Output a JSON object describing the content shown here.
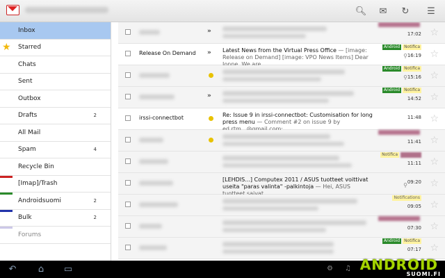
{
  "topbar": {
    "icons": [
      "search-icon",
      "compose-icon",
      "refresh-icon",
      "menu-icon"
    ]
  },
  "sidebar": {
    "items": [
      {
        "label": "Inbox",
        "count": "",
        "active": true
      },
      {
        "label": "Starred",
        "count": ""
      },
      {
        "label": "Chats",
        "count": ""
      },
      {
        "label": "Sent",
        "count": ""
      },
      {
        "label": "Outbox",
        "count": ""
      },
      {
        "label": "Drafts",
        "count": "2"
      },
      {
        "label": "All Mail",
        "count": ""
      },
      {
        "label": "Spam",
        "count": "4"
      },
      {
        "label": "Recycle Bin",
        "count": ""
      },
      {
        "label": "[Imap]/Trash",
        "count": "",
        "color": "#cc2222"
      },
      {
        "label": "Androidsuomi",
        "count": "2",
        "color": "#2a8a2a"
      },
      {
        "label": "Bulk",
        "count": "2",
        "color": "#2233aa"
      },
      {
        "label": "Forums",
        "count": "",
        "color": "#ccc8e8"
      }
    ]
  },
  "mails": [
    {
      "sender": "",
      "subject": "",
      "snippet": "",
      "time": "17:02",
      "marker": "»",
      "tags": []
    },
    {
      "sender": "Release On Demand",
      "subject": "Latest News from the Virtual Press Office",
      "snippet": " — [image: Release on Demand] [image: VPO News Items] Dear Jonne, We are",
      "time": "16:19",
      "marker": "»",
      "tags": [
        "Android",
        "Notifica"
      ],
      "attach": true
    },
    {
      "sender": "",
      "subject": "",
      "snippet": "",
      "time": "15:16",
      "marker": "imp",
      "tags": [
        "Android",
        "Notifica"
      ],
      "attach": true
    },
    {
      "sender": "",
      "subject": "",
      "snippet": "",
      "time": "14:52",
      "marker": "»",
      "tags": [
        "Android",
        "Notifica"
      ]
    },
    {
      "sender": "irssi-connectbot",
      "subject": "Re: Issue 9 in irssi-connectbot: Customisation for long press menu",
      "snippet": " — Comment #2 on issue 9 by ed.rtm...@gmail.com:",
      "time": "11:48",
      "marker": "imp",
      "tags": []
    },
    {
      "sender": "",
      "subject": "",
      "snippet": "",
      "time": "11:41",
      "marker": "imp",
      "tags": []
    },
    {
      "sender": "",
      "subject": "",
      "snippet": "",
      "time": "11:11",
      "marker": "",
      "tags": [
        "Notifica"
      ]
    },
    {
      "sender": "",
      "subject": "[LEHDIS...] Computex 2011 / ASUS tuotteet voittivat useita \"paras valinta\" -palkintoja",
      "snippet": " — Hei, ASUS tuotteet saivat",
      "time": "09:20",
      "marker": "",
      "tags": [],
      "attach": true
    },
    {
      "sender": "",
      "subject": "",
      "snippet": "",
      "time": "09:05",
      "marker": "",
      "tags": [
        "Notifications"
      ]
    },
    {
      "sender": "",
      "subject": "",
      "snippet": "",
      "time": "07:30",
      "marker": "",
      "tags": []
    },
    {
      "sender": "",
      "subject": "",
      "snippet": "",
      "time": "07:17",
      "marker": "",
      "tags": [
        "Android",
        "Notifica"
      ]
    }
  ],
  "tag_labels": {
    "android": "Android",
    "notifica": "Notifica",
    "notifications": "Notifications"
  },
  "brand": {
    "main": "ANDROID",
    "sub": "SUOMI.FI"
  },
  "colors": {
    "accent_selected": "#a8c8f0",
    "star": "#f2b90c",
    "android_tag": "#2a8a2a",
    "brand_green": "#a4d400"
  }
}
